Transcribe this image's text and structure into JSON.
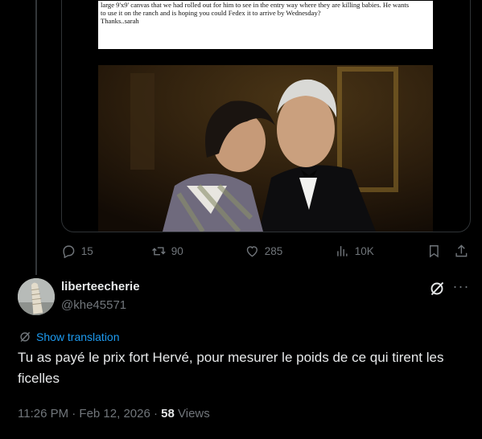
{
  "document": {
    "lines": [
      "large 9'x9' canvas that we had rolled out for him to see in the entry way where they are killing babies. He wants",
      "to use it on the ranch and is hoping you could Fedex it to arrive by Wednesday?",
      "Thanks..sarah"
    ]
  },
  "actions": {
    "replies": "15",
    "reposts": "90",
    "likes": "285",
    "views": "10K"
  },
  "reply": {
    "display_name": "liberteecherie",
    "handle": "@khe45571",
    "show_translation": "Show translation",
    "text": "Tu as payé le prix fort Hervé, pour mesurer le poids de ce qui tirent les ficelles",
    "time": "11:26 PM · Feb 12, 2026 · ",
    "view_count": "58",
    "views_label": " Views"
  },
  "colors": {
    "background": "#000000",
    "text": "#e7e9ea",
    "muted": "#71767b",
    "accent": "#1d9bf0",
    "border": "#2f3336"
  },
  "icons": [
    "reply-icon",
    "repost-icon",
    "like-icon",
    "views-icon",
    "bookmark-icon",
    "share-icon",
    "grok-icon",
    "more-icon",
    "translate-icon"
  ]
}
